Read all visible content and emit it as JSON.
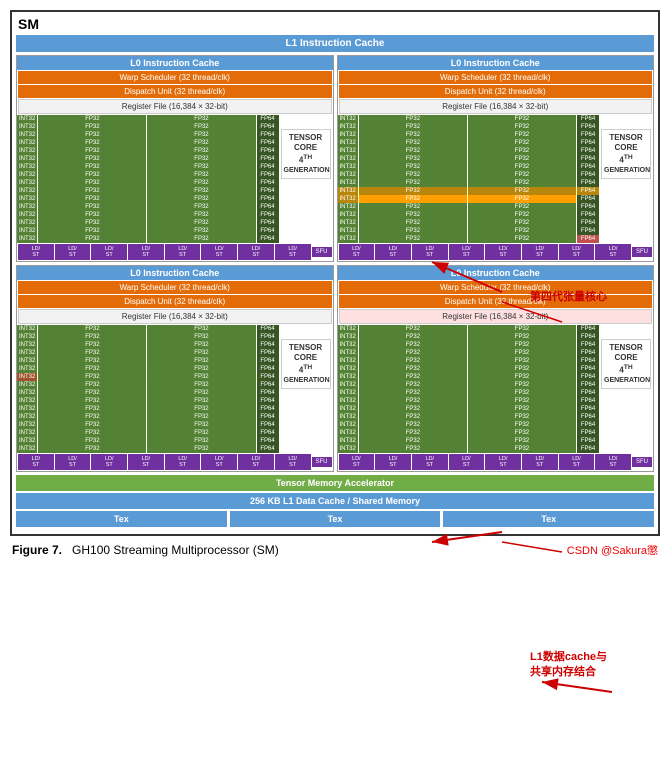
{
  "sm_label": "SM",
  "l1_instruction_cache": "L1 Instruction Cache",
  "l0_instruction_cache": "L0 Instruction Cache",
  "warp_scheduler": "Warp Scheduler (32 thread/clk)",
  "dispatch_unit": "Dispatch Unit (32 thread/clk)",
  "register_file": "Register File (16,384 × 32-bit)",
  "tensor_core": "TENSOR CORE",
  "generation_label": "4TH GENERATION",
  "ld_st": "LD/\nST",
  "sfu": "SFU",
  "tensor_memory_accelerator": "Tensor Memory Accelerator",
  "l1_data_cache": "256 KB L1 Data Cache / Shared Memory",
  "tex": "Tex",
  "figure_label": "Figure 7.",
  "figure_title": "GH100 Streaming Multiprocessor (SM)",
  "csdn_credit": "CSDN @Sakura懲",
  "annotation1": "第四代张量核心",
  "annotation2": "L1数据cache与\n共享内存结合",
  "cu_types": {
    "int32": "INT32",
    "fp32": "FP32",
    "fp64": "FP64"
  }
}
